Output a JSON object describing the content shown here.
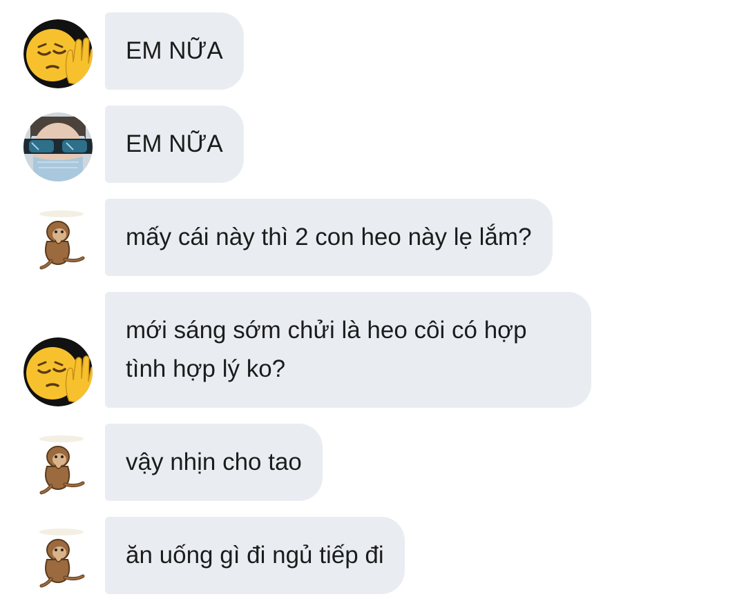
{
  "messages": [
    {
      "sender": "emoji-face",
      "text": "EM NỮA"
    },
    {
      "sender": "sunglasses-guy",
      "text": "EM NỮA"
    },
    {
      "sender": "monkey-sticker",
      "text": "mấy cái này thì 2 con heo này lẹ lắm?"
    },
    {
      "sender": "emoji-face",
      "lines": [
        "mới sáng sớm chửi là heo côi có hợp",
        "tình hợp lý ko?"
      ]
    },
    {
      "sender": "monkey-sticker",
      "text": "vậy nhịn cho tao"
    },
    {
      "sender": "monkey-sticker",
      "text": "ăn uống gì đi ngủ tiếp đi"
    }
  ],
  "colors": {
    "bubble_bg": "#e9edf2",
    "text": "#1c1c1c",
    "emoji_yellow": "#f7c12e"
  },
  "icons": {
    "emoji-face": "pensive-face-with-raised-hand-icon",
    "sunglasses-guy": "user-photo-avatar",
    "monkey-sticker": "monkey-sticker-icon"
  }
}
